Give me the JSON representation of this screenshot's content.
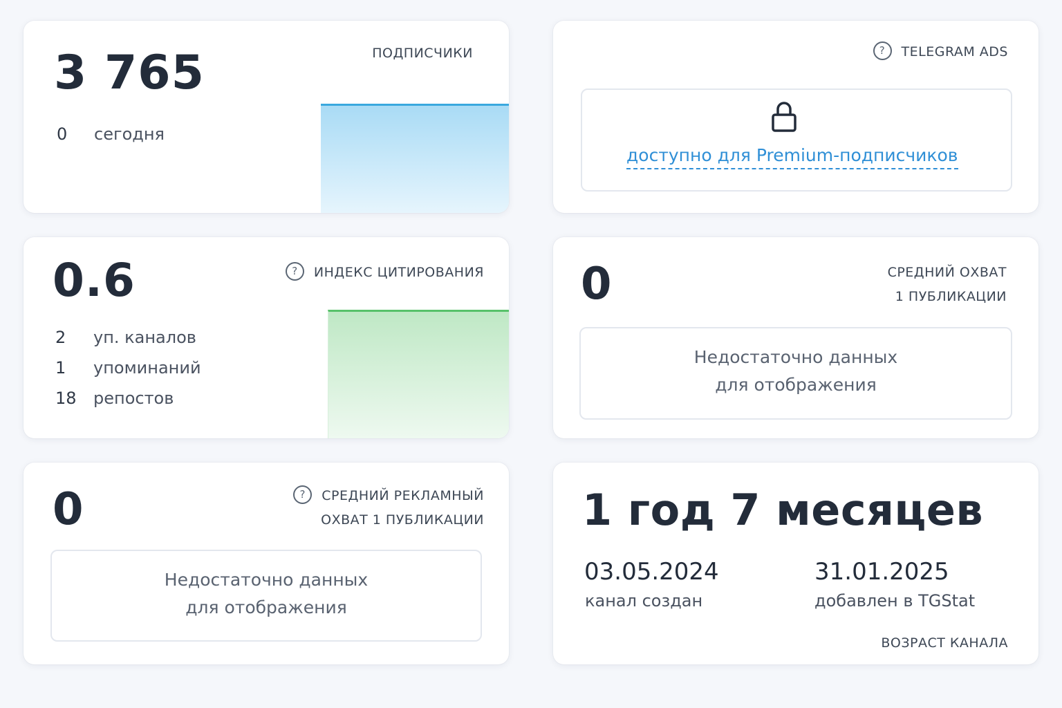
{
  "subscribers": {
    "value": "3 765",
    "caption": "ПОДПИСЧИКИ",
    "today_value": "0",
    "today_label": "сегодня"
  },
  "telegram_ads": {
    "caption": "TELEGRAM ADS",
    "premium_link": "доступно для Premium-подписчиков",
    "lock_icon": "lock-icon"
  },
  "citation": {
    "value": "0.6",
    "caption": "ИНДЕКС ЦИТИРОВАНИЯ",
    "stats": [
      {
        "value": "2",
        "label": "уп. каналов"
      },
      {
        "value": "1",
        "label": "упоминаний"
      },
      {
        "value": "18",
        "label": "репостов"
      }
    ]
  },
  "avg_reach": {
    "value": "0",
    "caption_line1": "СРЕДНИЙ ОХВАТ",
    "caption_line2": "1 ПУБЛИКАЦИИ",
    "nodata_line1": "Недостаточно данных",
    "nodata_line2": "для отображения"
  },
  "avg_ad_reach": {
    "value": "0",
    "caption_line1": "СРЕДНИЙ РЕКЛАМНЫЙ",
    "caption_line2": "ОХВАТ 1 ПУБЛИКАЦИИ",
    "nodata_line1": "Недостаточно данных",
    "nodata_line2": "для отображения"
  },
  "channel_age": {
    "value": "1 год 7 месяцев",
    "created_date": "03.05.2024",
    "created_label": "канал создан",
    "added_date": "31.01.2025",
    "added_label": "добавлен в TGStat",
    "caption": "ВОЗРАСТ КАНАЛА"
  },
  "colors": {
    "accent_blue": "#2f8fd6",
    "subscribers_chart": "#a9dbf5",
    "citation_chart": "#bfe8c5"
  }
}
